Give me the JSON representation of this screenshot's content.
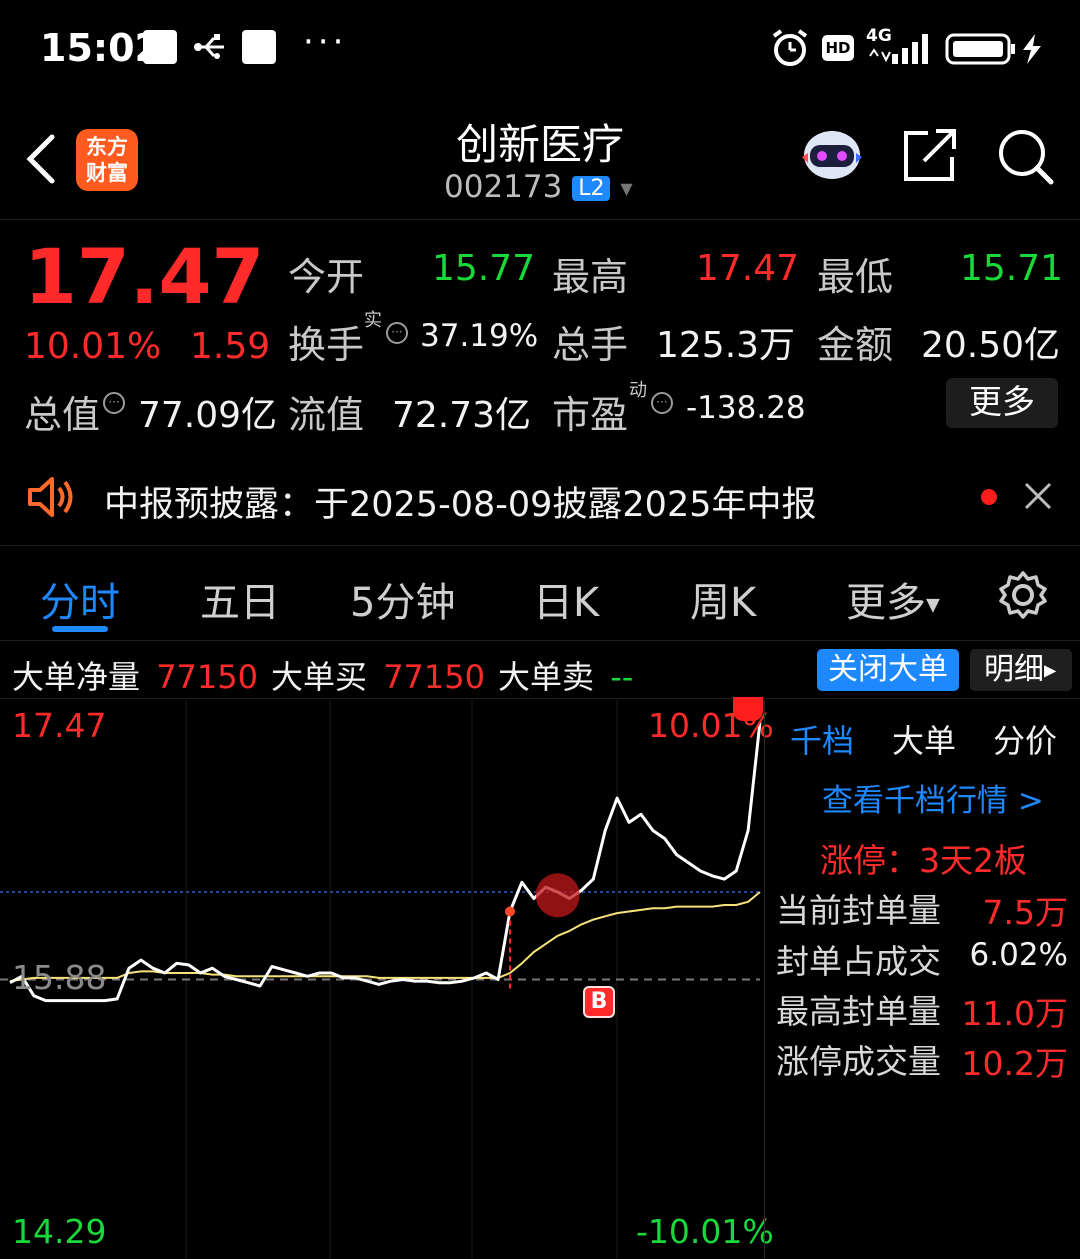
{
  "status_bar": {
    "time": "15:02",
    "network": "4G",
    "hd": "HD"
  },
  "header": {
    "logo_line1": "东方",
    "logo_line2": "财富",
    "title": "创新医疗",
    "code": "002173",
    "level_badge": "L2"
  },
  "quote": {
    "price": "17.47",
    "change_pct": "10.01%",
    "change_amt": "1.59",
    "open_label": "今开",
    "open_value": "15.77",
    "high_label": "最高",
    "high_value": "17.47",
    "low_label": "最低",
    "low_value": "15.71",
    "turnover_label": "换手",
    "turnover_sup": "实",
    "turnover_value": "37.19%",
    "volume_label": "总手",
    "volume_value": "125.3万",
    "amount_label": "金额",
    "amount_value": "20.50亿",
    "mktcap_label": "总值",
    "mktcap_value": "77.09亿",
    "float_label": "流值",
    "float_value": "72.73亿",
    "pe_label": "市盈",
    "pe_sup": "动",
    "pe_value": "-138.28",
    "more_button": "更多"
  },
  "notice": {
    "text": "中报预披露：于2025-08-09披露2025年中报"
  },
  "tabs": {
    "items": [
      "分时",
      "五日",
      "5分钟",
      "日K",
      "周K",
      "更多"
    ]
  },
  "big_order": {
    "net_label": "大单净量",
    "net_value": "77150",
    "buy_label": "大单买",
    "buy_value": "77150",
    "sell_label": "大单卖",
    "sell_value": "--",
    "close_button": "关闭大单",
    "detail_button": "明细"
  },
  "chart": {
    "y_max": "17.47",
    "y_mid": "15.88",
    "y_min": "14.29",
    "pct_max": "10.01%",
    "pct_min": "-10.01%",
    "marker": "B"
  },
  "chart_data": {
    "type": "line",
    "title": "",
    "ylim": [
      14.29,
      17.47
    ],
    "prev_close": 15.88,
    "series": [
      {
        "name": "",
        "values": [
          15.86,
          15.9,
          15.78,
          15.75,
          15.75,
          15.75,
          15.75,
          15.75,
          15.75,
          15.76,
          15.95,
          16.0,
          15.95,
          15.92,
          15.98,
          15.97,
          15.92,
          15.95,
          15.9,
          15.88,
          15.86,
          15.84,
          15.96,
          15.94,
          15.92,
          15.9,
          15.92,
          15.92,
          15.89,
          15.89,
          15.87,
          15.85,
          15.87,
          15.88,
          15.87,
          15.87,
          15.86,
          15.86,
          15.87,
          15.89,
          15.92,
          15.88,
          16.3,
          16.48,
          16.38,
          16.45,
          16.42,
          16.38,
          16.43,
          16.5,
          16.8,
          17.0,
          16.85,
          16.9,
          16.8,
          16.75,
          16.65,
          16.6,
          16.55,
          16.52,
          16.5,
          16.55,
          16.8,
          17.47
        ]
      },
      {
        "name": "",
        "values": [
          15.87,
          15.88,
          15.89,
          15.89,
          15.89,
          15.89,
          15.89,
          15.89,
          15.89,
          15.89,
          15.92,
          15.93,
          15.93,
          15.92,
          15.92,
          15.92,
          15.92,
          15.91,
          15.91,
          15.9,
          15.9,
          15.9,
          15.9,
          15.9,
          15.9,
          15.9,
          15.9,
          15.9,
          15.9,
          15.9,
          15.9,
          15.89,
          15.89,
          15.89,
          15.89,
          15.89,
          15.89,
          15.89,
          15.89,
          15.89,
          15.89,
          15.89,
          15.92,
          15.98,
          16.05,
          16.1,
          16.15,
          16.18,
          16.22,
          16.25,
          16.27,
          16.29,
          16.3,
          16.31,
          16.32,
          16.32,
          16.33,
          16.33,
          16.33,
          16.33,
          16.34,
          16.34,
          16.36,
          16.42
        ]
      }
    ]
  },
  "side_panel": {
    "tabs": [
      "千档",
      "大单",
      "分价"
    ],
    "link": "查看千档行情 >",
    "limit_up": "涨停：3天2板",
    "rows": [
      {
        "label": "当前封单量",
        "value": "7.5万"
      },
      {
        "label": "封单占成交",
        "value": "6.02%"
      },
      {
        "label": "最高封单量",
        "value": "11.0万"
      },
      {
        "label": "涨停成交量",
        "value": "10.2万"
      }
    ]
  },
  "colors": {
    "up": "#ff2b2b",
    "down": "#19d93a",
    "accent": "#1e88ff",
    "avg_line": "#f5e27a"
  }
}
